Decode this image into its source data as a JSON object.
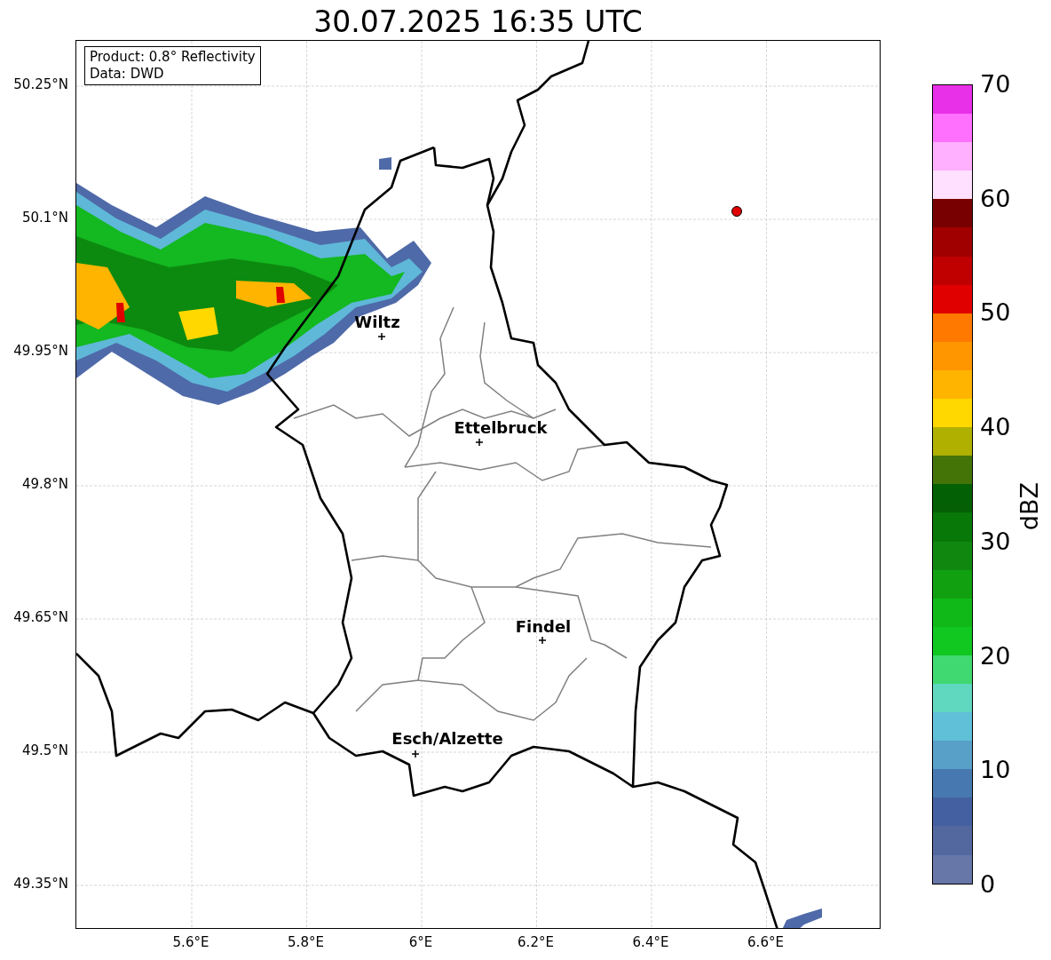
{
  "title": "30.07.2025 16:35 UTC",
  "info_box": {
    "lines": [
      "Product: 0.8° Reflectivity",
      "Data: DWD"
    ]
  },
  "y_ticks": [
    "50.25°N",
    "50.1°N",
    "49.95°N",
    "49.8°N",
    "49.65°N",
    "49.5°N",
    "49.35°N"
  ],
  "x_ticks": [
    "5.6°E",
    "5.8°E",
    "6°E",
    "6.2°E",
    "6.4°E",
    "6.6°E"
  ],
  "cities": [
    {
      "name": "Wiltz"
    },
    {
      "name": "Ettelbruck"
    },
    {
      "name": "Findel"
    },
    {
      "name": "Esch/Alzette"
    }
  ],
  "colorbar": {
    "label": "dBZ",
    "ticks": [
      "70",
      "60",
      "50",
      "40",
      "30",
      "20",
      "10",
      "0"
    ],
    "segments": [
      {
        "color": "#e830e8"
      },
      {
        "color": "#ff70ff"
      },
      {
        "color": "#ffb0ff"
      },
      {
        "color": "#ffe0ff"
      },
      {
        "color": "#780000"
      },
      {
        "color": "#a00000"
      },
      {
        "color": "#c00000"
      },
      {
        "color": "#e00000"
      },
      {
        "color": "#ff7800"
      },
      {
        "color": "#ff9600"
      },
      {
        "color": "#ffb400"
      },
      {
        "color": "#ffd800"
      },
      {
        "color": "#b0b000"
      },
      {
        "color": "#447408"
      },
      {
        "color": "#046004"
      },
      {
        "color": "#087808"
      },
      {
        "color": "#108810"
      },
      {
        "color": "#10a010"
      },
      {
        "color": "#10b818"
      },
      {
        "color": "#10c820"
      },
      {
        "color": "#40d870"
      },
      {
        "color": "#60d8c0"
      },
      {
        "color": "#60c0d8"
      },
      {
        "color": "#58a0c8"
      },
      {
        "color": "#4878b0"
      },
      {
        "color": "#4460a0"
      },
      {
        "color": "#5468a0"
      },
      {
        "color": "#6677a8"
      }
    ]
  }
}
